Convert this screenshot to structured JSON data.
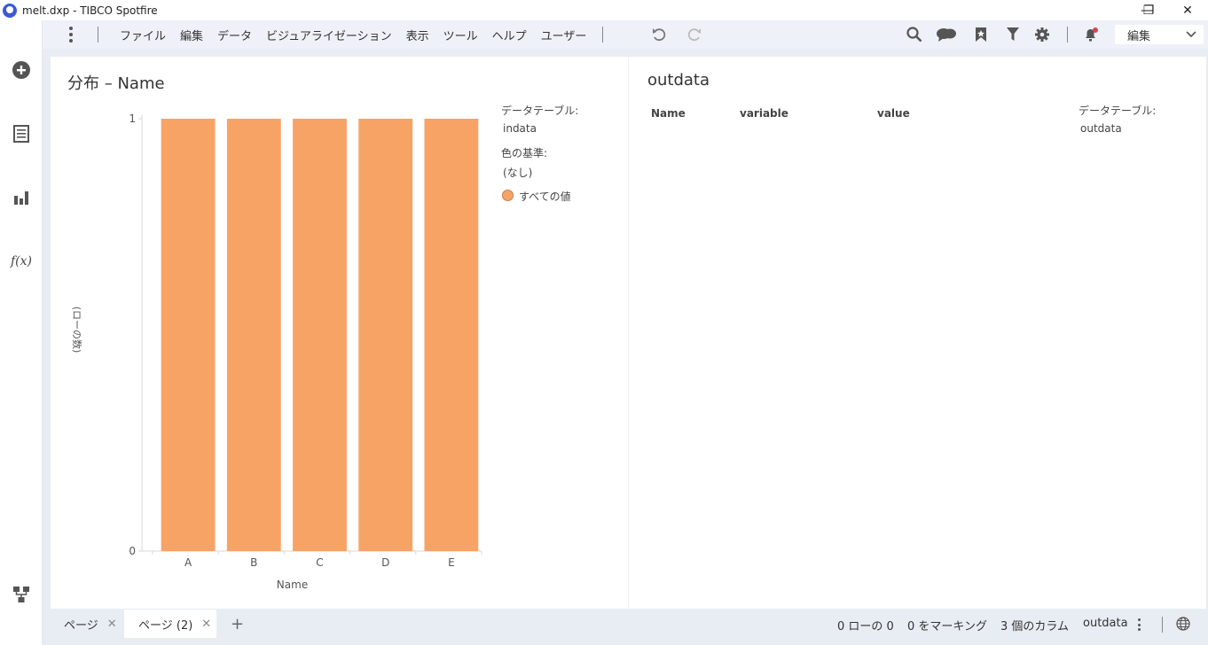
{
  "window": {
    "title": "melt.dxp - TIBCO Spotfire",
    "minimize": "—",
    "restore": "❐",
    "close": "✕"
  },
  "menu": {
    "items": [
      "ファイル",
      "編集",
      "データ",
      "ビジュアライゼーション",
      "表示",
      "ツール",
      "ヘルプ",
      "ユーザー"
    ],
    "mode_label": "編集"
  },
  "left_rail": {
    "icons": [
      "add-icon",
      "data-table-icon",
      "visualization-icon",
      "fx-icon",
      "data-canvas-icon"
    ],
    "fx_label": "f(x)"
  },
  "toolbar_icons": [
    "undo-icon",
    "redo-icon",
    "search-icon",
    "comments-icon",
    "bookmark-icon",
    "filter-icon",
    "settings-icon",
    "notification-icon"
  ],
  "accent": "#3c59d6",
  "notification_color": "#e0404a",
  "bar_panel": {
    "title": "分布 – Name",
    "legend": {
      "table_label": "データテーブル:",
      "table_value": "indata",
      "color_label": "色の基準:",
      "color_value": "(なし)",
      "item_label": "すべての値",
      "item_color": "#f7a366"
    }
  },
  "chart_data": {
    "type": "bar",
    "categories": [
      "A",
      "B",
      "C",
      "D",
      "E"
    ],
    "values": [
      1,
      1,
      1,
      1,
      1
    ],
    "title": "分布 – Name",
    "xlabel": "Name",
    "ylabel": "(ローの数)",
    "ylim": [
      0,
      1
    ],
    "yticks": [
      0,
      1
    ],
    "grid": false,
    "legend": "right",
    "bar_color": "#f7a366"
  },
  "table_panel": {
    "title": "outdata",
    "columns": [
      "Name",
      "variable",
      "value"
    ],
    "rows": [],
    "legend": {
      "table_label": "データテーブル:",
      "table_value": "outdata"
    }
  },
  "bottom": {
    "tabs": [
      {
        "label": "ページ",
        "active": false
      },
      {
        "label": "ページ (2)",
        "active": true
      }
    ],
    "close_glyph": "✕",
    "add_glyph": "+",
    "status": {
      "rows": "0 ローの 0",
      "marked": "0 をマーキング",
      "columns": "3 個のカラム",
      "table": "outdata"
    }
  }
}
